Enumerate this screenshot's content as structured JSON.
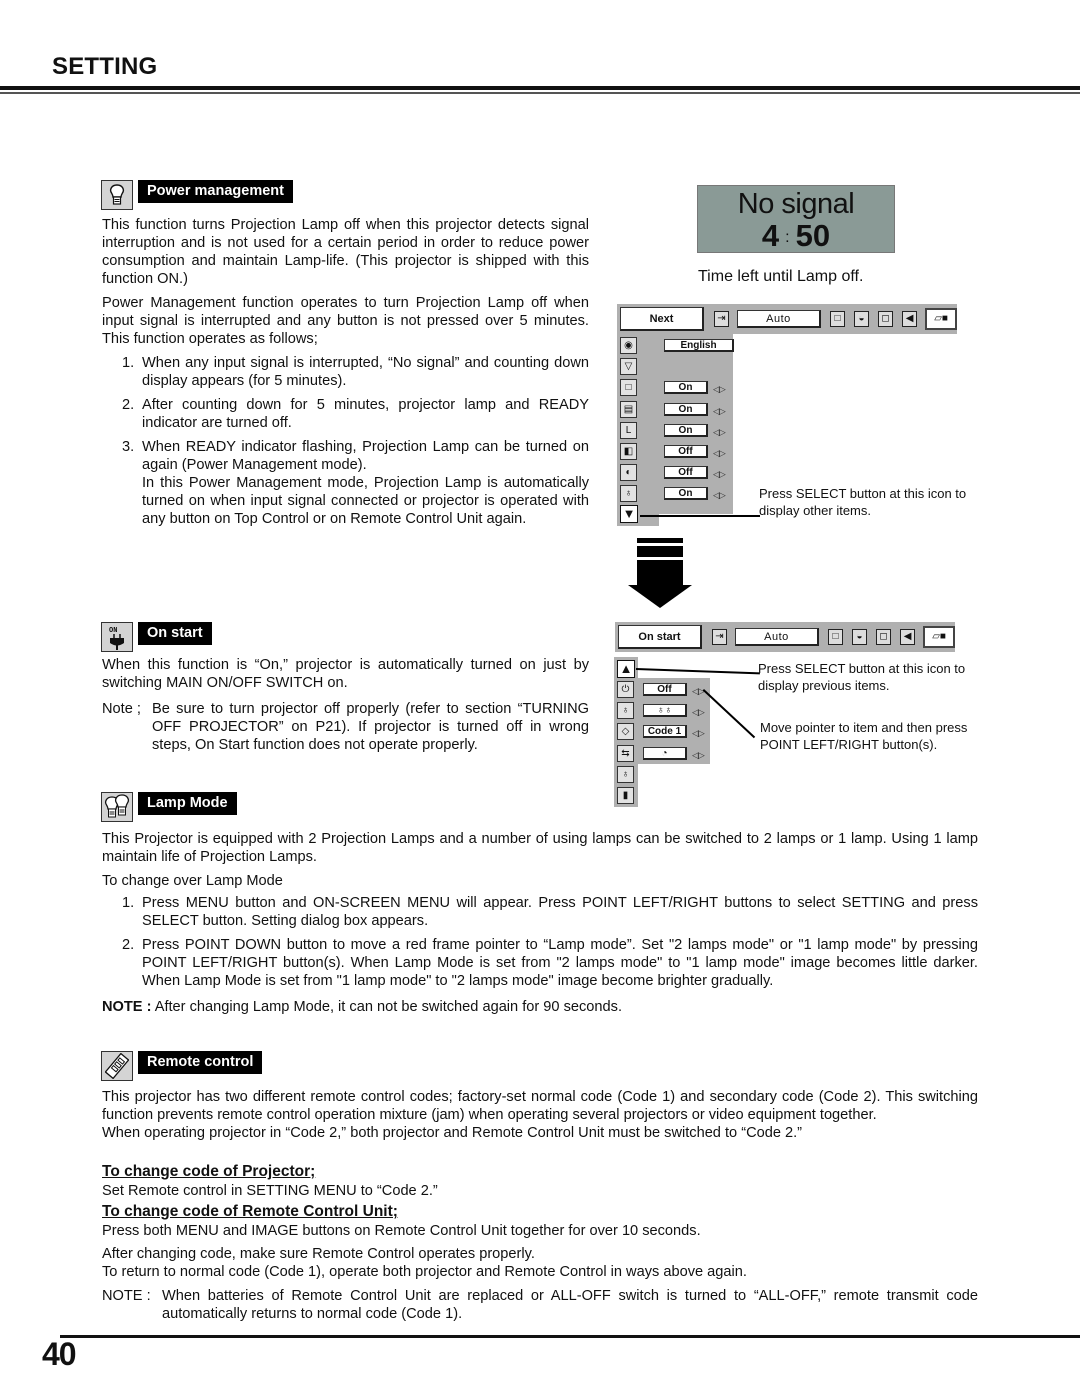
{
  "header": {
    "title": "SETTING"
  },
  "page_number": "40",
  "power_management": {
    "icon": "lamp-bulb-icon",
    "label": "Power management",
    "para1": "This function turns Projection Lamp off when this projector detects signal interruption and is not used for a certain period in order to reduce power consumption and maintain Lamp-life.  (This projector is shipped with this function ON.)",
    "para2": "Power Management function operates to turn Projection Lamp off when input signal is interrupted and any button is not pressed over 5 minutes.  This function operates as follows;",
    "steps": [
      {
        "num": "1.",
        "text": "When any input signal is interrupted, “No signal” and counting down display appears (for 5 minutes)."
      },
      {
        "num": "2.",
        "text": "After counting down for 5 minutes, projector lamp and READY indicator are turned off."
      },
      {
        "num": "3.",
        "text": "When READY indicator flashing, Projection Lamp can be turned on again (Power Management mode).",
        "extra": "In this Power Management mode, Projection Lamp is automatically turned on when input signal connected or projector is operated with any button on Top Control or on Remote Control Unit again."
      }
    ]
  },
  "no_signal_display": {
    "line1": "No signal",
    "minutes": "4",
    "seconds": "50",
    "caption": "Time left until Lamp off."
  },
  "osd_menu_1": {
    "title": "Next",
    "source_value": "Auto",
    "toolbar_icons": [
      "input-icon",
      "screen-icon",
      "color-icon",
      "image-icon",
      "sound-icon",
      "setting-icon"
    ],
    "rows": [
      {
        "icon": "language-globe-icon",
        "glyph": "◉",
        "value": "English",
        "arrows": false
      },
      {
        "icon": "keystone-icon",
        "glyph": "▽",
        "value": "",
        "arrows": false
      },
      {
        "icon": "blue-back-icon",
        "glyph": "□",
        "value": "On",
        "arrows": true
      },
      {
        "icon": "display-icon",
        "glyph": "▤",
        "value": "On",
        "arrows": true
      },
      {
        "icon": "logo-icon",
        "glyph": "L",
        "value": "On",
        "arrows": true
      },
      {
        "icon": "ceiling-icon",
        "glyph": "◧",
        "value": "Off",
        "arrows": true
      },
      {
        "icon": "rear-icon",
        "glyph": "◐",
        "value": "Off",
        "arrows": true
      },
      {
        "icon": "power-management-icon",
        "glyph": "♁",
        "value": "On",
        "arrows": true
      }
    ],
    "next_icon": "down-triangle-icon",
    "note": "Press SELECT button at this icon to display other items."
  },
  "osd_menu_2": {
    "title": "On start",
    "source_value": "Auto",
    "prev_icon": "up-triangle-icon",
    "rows": [
      {
        "icon": "on-start-icon",
        "glyph": "⏻",
        "value": "Off",
        "arrows": true
      },
      {
        "icon": "lamp-mode-icon",
        "glyph": "♁",
        "value": "♁♁",
        "arrows": true
      },
      {
        "icon": "remote-control-icon",
        "glyph": "◇",
        "value": "Code 1",
        "arrows": true
      },
      {
        "icon": "usb-icon",
        "glyph": "⇆",
        "value": "◔",
        "arrows": true
      },
      {
        "icon": "lamp-counter-icon",
        "glyph": "♁",
        "value": null,
        "arrows": false
      },
      {
        "icon": "exit-door-icon",
        "glyph": "▮",
        "value": null,
        "arrows": false
      }
    ],
    "note_prev": "Press SELECT button at this icon to display previous items.",
    "note_point": "Move pointer to item and then press POINT LEFT/RIGHT button(s)."
  },
  "on_start": {
    "icon": "on-start-plug-icon",
    "label": "On start",
    "para": "When this function is “On,” projector is automatically turned on just by switching MAIN ON/OFF SWITCH on.",
    "note_label": "Note ;",
    "note": "Be sure to turn projector off properly (refer to section “TURNING OFF PROJECTOR” on P21).  If projector is turned off in wrong steps, On Start function does not operate properly."
  },
  "lamp_mode": {
    "icon": "two-lamps-icon",
    "label": "Lamp Mode",
    "para": "This Projector is equipped with 2 Projection Lamps and a number of using lamps can be switched to 2 lamps or 1 lamp. Using 1 lamp maintain life of Projection Lamps.",
    "intro": "To change over Lamp Mode",
    "steps": [
      {
        "num": "1.",
        "text": "Press MENU button and ON-SCREEN MENU will appear.  Press POINT LEFT/RIGHT buttons to select SETTING and press SELECT button.  Setting dialog box appears."
      },
      {
        "num": "2.",
        "text": "Press POINT DOWN button to move a red frame pointer to “Lamp mode”.  Set \"2 lamps mode\" or \"1 lamp mode\" by pressing POINT LEFT/RIGHT button(s).  When Lamp Mode is set from \"2 lamps mode\" to \"1 lamp mode\" image becomes little darker.  When Lamp Mode is set from \"1 lamp mode\" to \"2 lamps mode\" image become brighter gradually."
      }
    ],
    "note_label": "NOTE :",
    "note": "After changing Lamp Mode, it can not be switched again for 90 seconds."
  },
  "remote_control": {
    "icon": "remote-control-icon",
    "label": "Remote control",
    "para1": "This projector has two different remote control codes; factory-set normal code (Code 1) and secondary code (Code 2). This switching function prevents remote control operation mixture (jam) when operating several projectors or video equipment together.",
    "para2": "When operating projector in “Code 2,”  both projector and Remote Control Unit must be switched to “Code 2.”",
    "sub1_title": "To change code of Projector;",
    "sub1_text": "Set Remote control in SETTING MENU to “Code 2.”",
    "sub2_title": "To change code of Remote Control Unit;",
    "sub2_text": "Press both MENU and IMAGE buttons on Remote Control Unit together for over 10 seconds.",
    "after1": "After changing code, make sure Remote Control operates properly.",
    "after2": "To return to normal code (Code 1), operate both projector and Remote Control in ways above again.",
    "note_label": "NOTE :",
    "note": "When batteries of Remote Control Unit are replaced or ALL-OFF switch is turned to “ALL-OFF,”  remote transmit code automatically returns to normal code (Code 1)."
  }
}
